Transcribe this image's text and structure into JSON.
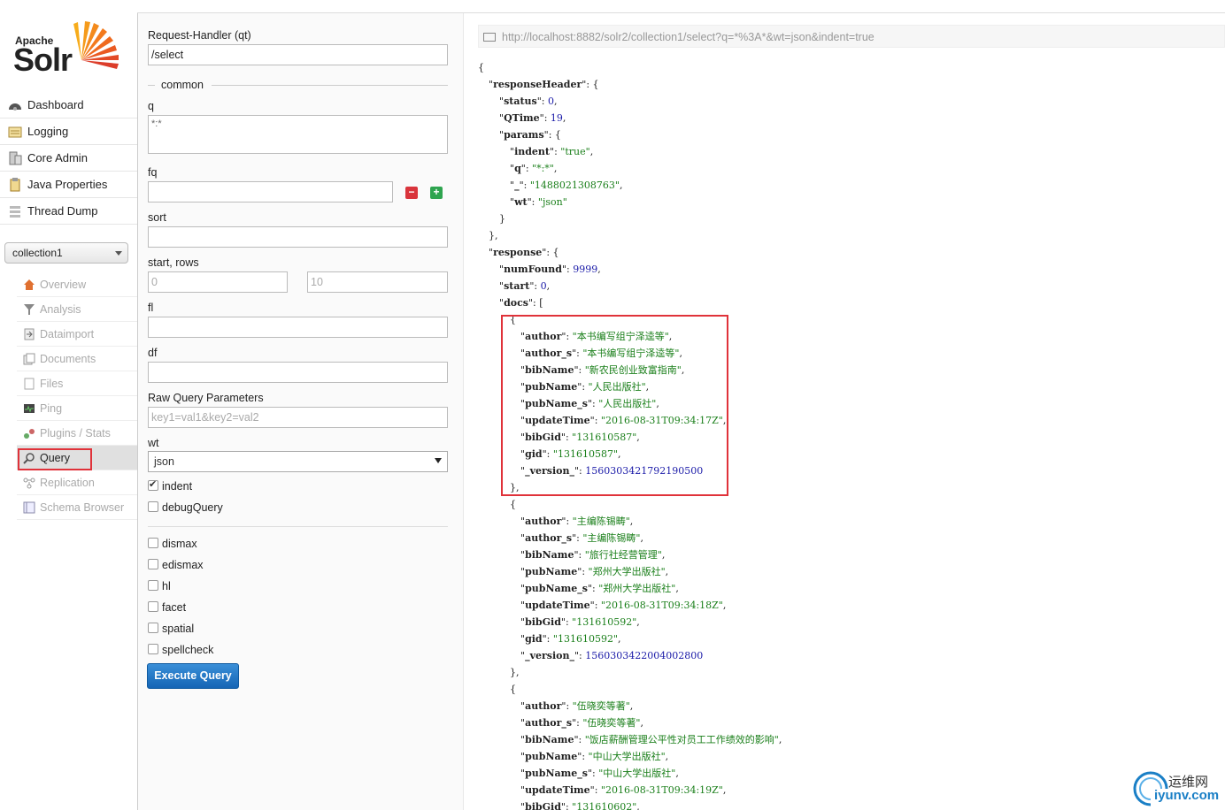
{
  "logo": {
    "apache": "Apache",
    "solr": "Solr"
  },
  "main_nav": [
    {
      "label": "Dashboard",
      "icon": "dashboard-icon"
    },
    {
      "label": "Logging",
      "icon": "logging-icon"
    },
    {
      "label": "Core Admin",
      "icon": "core-admin-icon"
    },
    {
      "label": "Java Properties",
      "icon": "java-icon"
    },
    {
      "label": "Thread Dump",
      "icon": "thread-icon"
    }
  ],
  "core_selector": {
    "value": "collection1"
  },
  "core_nav": [
    {
      "label": "Overview",
      "icon": "home-icon"
    },
    {
      "label": "Analysis",
      "icon": "funnel-icon"
    },
    {
      "label": "Dataimport",
      "icon": "import-icon"
    },
    {
      "label": "Documents",
      "icon": "documents-icon"
    },
    {
      "label": "Files",
      "icon": "folder-icon"
    },
    {
      "label": "Ping",
      "icon": "ping-icon"
    },
    {
      "label": "Plugins / Stats",
      "icon": "plugins-icon"
    },
    {
      "label": "Query",
      "icon": "magnifier-icon"
    },
    {
      "label": "Replication",
      "icon": "replication-icon"
    },
    {
      "label": "Schema Browser",
      "icon": "schema-icon"
    }
  ],
  "form": {
    "handler_label": "Request-Handler (qt)",
    "handler_value": "/select",
    "common_legend": "common",
    "q_label": "q",
    "q_value": "*:*",
    "fq_label": "fq",
    "fq_value": "",
    "sort_label": "sort",
    "sort_value": "",
    "start_rows_label": "start, rows",
    "start_placeholder": "0",
    "rows_placeholder": "10",
    "fl_label": "fl",
    "df_label": "df",
    "raw_label": "Raw Query Parameters",
    "raw_placeholder": "key1=val1&key2=val2",
    "wt_label": "wt",
    "wt_value": "json",
    "indent_label": "indent",
    "debug_label": "debugQuery",
    "dismax_label": "dismax",
    "edismax_label": "edismax",
    "hl_label": "hl",
    "facet_label": "facet",
    "spatial_label": "spatial",
    "spellcheck_label": "spellcheck",
    "execute_label": "Execute Query"
  },
  "result": {
    "url": "http://localhost:8882/solr2/collection1/select?q=*%3A*&wt=json&indent=true",
    "lines": [
      {
        "i": 0,
        "parts": [
          [
            "p",
            "{"
          ]
        ]
      },
      {
        "i": 1,
        "parts": [
          [
            "p",
            "\""
          ],
          [
            "k",
            "responseHeader"
          ],
          [
            "p",
            "\": {"
          ]
        ]
      },
      {
        "i": 2,
        "parts": [
          [
            "p",
            "\""
          ],
          [
            "k",
            "status"
          ],
          [
            "p",
            "\": "
          ],
          [
            "n",
            "0"
          ],
          [
            "p",
            ","
          ]
        ]
      },
      {
        "i": 2,
        "parts": [
          [
            "p",
            "\""
          ],
          [
            "k",
            "QTime"
          ],
          [
            "p",
            "\": "
          ],
          [
            "n",
            "19"
          ],
          [
            "p",
            ","
          ]
        ]
      },
      {
        "i": 2,
        "parts": [
          [
            "p",
            "\""
          ],
          [
            "k",
            "params"
          ],
          [
            "p",
            "\": {"
          ]
        ]
      },
      {
        "i": 3,
        "parts": [
          [
            "p",
            "\""
          ],
          [
            "k",
            "indent"
          ],
          [
            "p",
            "\": "
          ],
          [
            "s",
            "\"true\""
          ],
          [
            "p",
            ","
          ]
        ]
      },
      {
        "i": 3,
        "parts": [
          [
            "p",
            "\""
          ],
          [
            "k",
            "q"
          ],
          [
            "p",
            "\": "
          ],
          [
            "s",
            "\"*:*\""
          ],
          [
            "p",
            ","
          ]
        ]
      },
      {
        "i": 3,
        "parts": [
          [
            "p",
            "\""
          ],
          [
            "k",
            "_"
          ],
          [
            "p",
            "\": "
          ],
          [
            "s",
            "\"1488021308763\""
          ],
          [
            "p",
            ","
          ]
        ]
      },
      {
        "i": 3,
        "parts": [
          [
            "p",
            "\""
          ],
          [
            "k",
            "wt"
          ],
          [
            "p",
            "\": "
          ],
          [
            "s",
            "\"json\""
          ]
        ]
      },
      {
        "i": 2,
        "parts": [
          [
            "p",
            "}"
          ]
        ]
      },
      {
        "i": 1,
        "parts": [
          [
            "p",
            "},"
          ]
        ]
      },
      {
        "i": 1,
        "parts": [
          [
            "p",
            "\""
          ],
          [
            "k",
            "response"
          ],
          [
            "p",
            "\": {"
          ]
        ]
      },
      {
        "i": 2,
        "parts": [
          [
            "p",
            "\""
          ],
          [
            "k",
            "numFound"
          ],
          [
            "p",
            "\": "
          ],
          [
            "n",
            "9999"
          ],
          [
            "p",
            ","
          ]
        ]
      },
      {
        "i": 2,
        "parts": [
          [
            "p",
            "\""
          ],
          [
            "k",
            "start"
          ],
          [
            "p",
            "\": "
          ],
          [
            "n",
            "0"
          ],
          [
            "p",
            ","
          ]
        ]
      },
      {
        "i": 2,
        "parts": [
          [
            "p",
            "\""
          ],
          [
            "k",
            "docs"
          ],
          [
            "p",
            "\": ["
          ]
        ]
      },
      {
        "i": 3,
        "parts": [
          [
            "p",
            "{"
          ]
        ]
      },
      {
        "i": 4,
        "parts": [
          [
            "p",
            "\""
          ],
          [
            "k",
            "author"
          ],
          [
            "p",
            "\": "
          ],
          [
            "s",
            "\"本书编写组宁泽逵等\""
          ],
          [
            "p",
            ","
          ]
        ]
      },
      {
        "i": 4,
        "parts": [
          [
            "p",
            "\""
          ],
          [
            "k",
            "author_s"
          ],
          [
            "p",
            "\": "
          ],
          [
            "s",
            "\"本书编写组宁泽逵等\""
          ],
          [
            "p",
            ","
          ]
        ]
      },
      {
        "i": 4,
        "parts": [
          [
            "p",
            "\""
          ],
          [
            "k",
            "bibName"
          ],
          [
            "p",
            "\": "
          ],
          [
            "s",
            "\"新农民创业致富指南\""
          ],
          [
            "p",
            ","
          ]
        ]
      },
      {
        "i": 4,
        "parts": [
          [
            "p",
            "\""
          ],
          [
            "k",
            "pubName"
          ],
          [
            "p",
            "\": "
          ],
          [
            "s",
            "\"人民出版社\""
          ],
          [
            "p",
            ","
          ]
        ]
      },
      {
        "i": 4,
        "parts": [
          [
            "p",
            "\""
          ],
          [
            "k",
            "pubName_s"
          ],
          [
            "p",
            "\": "
          ],
          [
            "s",
            "\"人民出版社\""
          ],
          [
            "p",
            ","
          ]
        ]
      },
      {
        "i": 4,
        "parts": [
          [
            "p",
            "\""
          ],
          [
            "k",
            "updateTime"
          ],
          [
            "p",
            "\": "
          ],
          [
            "s",
            "\"2016-08-31T09:34:17Z\""
          ],
          [
            "p",
            ","
          ]
        ]
      },
      {
        "i": 4,
        "parts": [
          [
            "p",
            "\""
          ],
          [
            "k",
            "bibGid"
          ],
          [
            "p",
            "\": "
          ],
          [
            "s",
            "\"131610587\""
          ],
          [
            "p",
            ","
          ]
        ]
      },
      {
        "i": 4,
        "parts": [
          [
            "p",
            "\""
          ],
          [
            "k",
            "gid"
          ],
          [
            "p",
            "\": "
          ],
          [
            "s",
            "\"131610587\""
          ],
          [
            "p",
            ","
          ]
        ]
      },
      {
        "i": 4,
        "parts": [
          [
            "p",
            "\""
          ],
          [
            "k",
            "_version_"
          ],
          [
            "p",
            "\": "
          ],
          [
            "n",
            "1560303421792190500"
          ]
        ]
      },
      {
        "i": 3,
        "parts": [
          [
            "p",
            "},"
          ]
        ]
      },
      {
        "i": 3,
        "parts": [
          [
            "p",
            "{"
          ]
        ]
      },
      {
        "i": 4,
        "parts": [
          [
            "p",
            "\""
          ],
          [
            "k",
            "author"
          ],
          [
            "p",
            "\": "
          ],
          [
            "s",
            "\"主编陈锡畴\""
          ],
          [
            "p",
            ","
          ]
        ]
      },
      {
        "i": 4,
        "parts": [
          [
            "p",
            "\""
          ],
          [
            "k",
            "author_s"
          ],
          [
            "p",
            "\": "
          ],
          [
            "s",
            "\"主编陈锡畴\""
          ],
          [
            "p",
            ","
          ]
        ]
      },
      {
        "i": 4,
        "parts": [
          [
            "p",
            "\""
          ],
          [
            "k",
            "bibName"
          ],
          [
            "p",
            "\": "
          ],
          [
            "s",
            "\"旅行社经营管理\""
          ],
          [
            "p",
            ","
          ]
        ]
      },
      {
        "i": 4,
        "parts": [
          [
            "p",
            "\""
          ],
          [
            "k",
            "pubName"
          ],
          [
            "p",
            "\": "
          ],
          [
            "s",
            "\"郑州大学出版社\""
          ],
          [
            "p",
            ","
          ]
        ]
      },
      {
        "i": 4,
        "parts": [
          [
            "p",
            "\""
          ],
          [
            "k",
            "pubName_s"
          ],
          [
            "p",
            "\": "
          ],
          [
            "s",
            "\"郑州大学出版社\""
          ],
          [
            "p",
            ","
          ]
        ]
      },
      {
        "i": 4,
        "parts": [
          [
            "p",
            "\""
          ],
          [
            "k",
            "updateTime"
          ],
          [
            "p",
            "\": "
          ],
          [
            "s",
            "\"2016-08-31T09:34:18Z\""
          ],
          [
            "p",
            ","
          ]
        ]
      },
      {
        "i": 4,
        "parts": [
          [
            "p",
            "\""
          ],
          [
            "k",
            "bibGid"
          ],
          [
            "p",
            "\": "
          ],
          [
            "s",
            "\"131610592\""
          ],
          [
            "p",
            ","
          ]
        ]
      },
      {
        "i": 4,
        "parts": [
          [
            "p",
            "\""
          ],
          [
            "k",
            "gid"
          ],
          [
            "p",
            "\": "
          ],
          [
            "s",
            "\"131610592\""
          ],
          [
            "p",
            ","
          ]
        ]
      },
      {
        "i": 4,
        "parts": [
          [
            "p",
            "\""
          ],
          [
            "k",
            "_version_"
          ],
          [
            "p",
            "\": "
          ],
          [
            "n",
            "1560303422004002800"
          ]
        ]
      },
      {
        "i": 3,
        "parts": [
          [
            "p",
            "},"
          ]
        ]
      },
      {
        "i": 3,
        "parts": [
          [
            "p",
            "{"
          ]
        ]
      },
      {
        "i": 4,
        "parts": [
          [
            "p",
            "\""
          ],
          [
            "k",
            "author"
          ],
          [
            "p",
            "\": "
          ],
          [
            "s",
            "\"伍晓奕等著\""
          ],
          [
            "p",
            ","
          ]
        ]
      },
      {
        "i": 4,
        "parts": [
          [
            "p",
            "\""
          ],
          [
            "k",
            "author_s"
          ],
          [
            "p",
            "\": "
          ],
          [
            "s",
            "\"伍晓奕等著\""
          ],
          [
            "p",
            ","
          ]
        ]
      },
      {
        "i": 4,
        "parts": [
          [
            "p",
            "\""
          ],
          [
            "k",
            "bibName"
          ],
          [
            "p",
            "\": "
          ],
          [
            "s",
            "\"饭店薪酬管理公平性对员工工作绩效的影响\""
          ],
          [
            "p",
            ","
          ]
        ]
      },
      {
        "i": 4,
        "parts": [
          [
            "p",
            "\""
          ],
          [
            "k",
            "pubName"
          ],
          [
            "p",
            "\": "
          ],
          [
            "s",
            "\"中山大学出版社\""
          ],
          [
            "p",
            ","
          ]
        ]
      },
      {
        "i": 4,
        "parts": [
          [
            "p",
            "\""
          ],
          [
            "k",
            "pubName_s"
          ],
          [
            "p",
            "\": "
          ],
          [
            "s",
            "\"中山大学出版社\""
          ],
          [
            "p",
            ","
          ]
        ]
      },
      {
        "i": 4,
        "parts": [
          [
            "p",
            "\""
          ],
          [
            "k",
            "updateTime"
          ],
          [
            "p",
            "\": "
          ],
          [
            "s",
            "\"2016-08-31T09:34:19Z\""
          ],
          [
            "p",
            ","
          ]
        ]
      },
      {
        "i": 4,
        "parts": [
          [
            "p",
            "\""
          ],
          [
            "k",
            "bibGid"
          ],
          [
            "p",
            "\": "
          ],
          [
            "s",
            "\"131610602\""
          ],
          [
            "p",
            ","
          ]
        ]
      }
    ]
  },
  "watermark": {
    "t1": "运维网",
    "t2": "iyunv.com"
  },
  "colors": {
    "accent": "#1565b5",
    "highlight": "#e0323a",
    "string": "#1a7f1a",
    "number": "#1a1aa8"
  }
}
